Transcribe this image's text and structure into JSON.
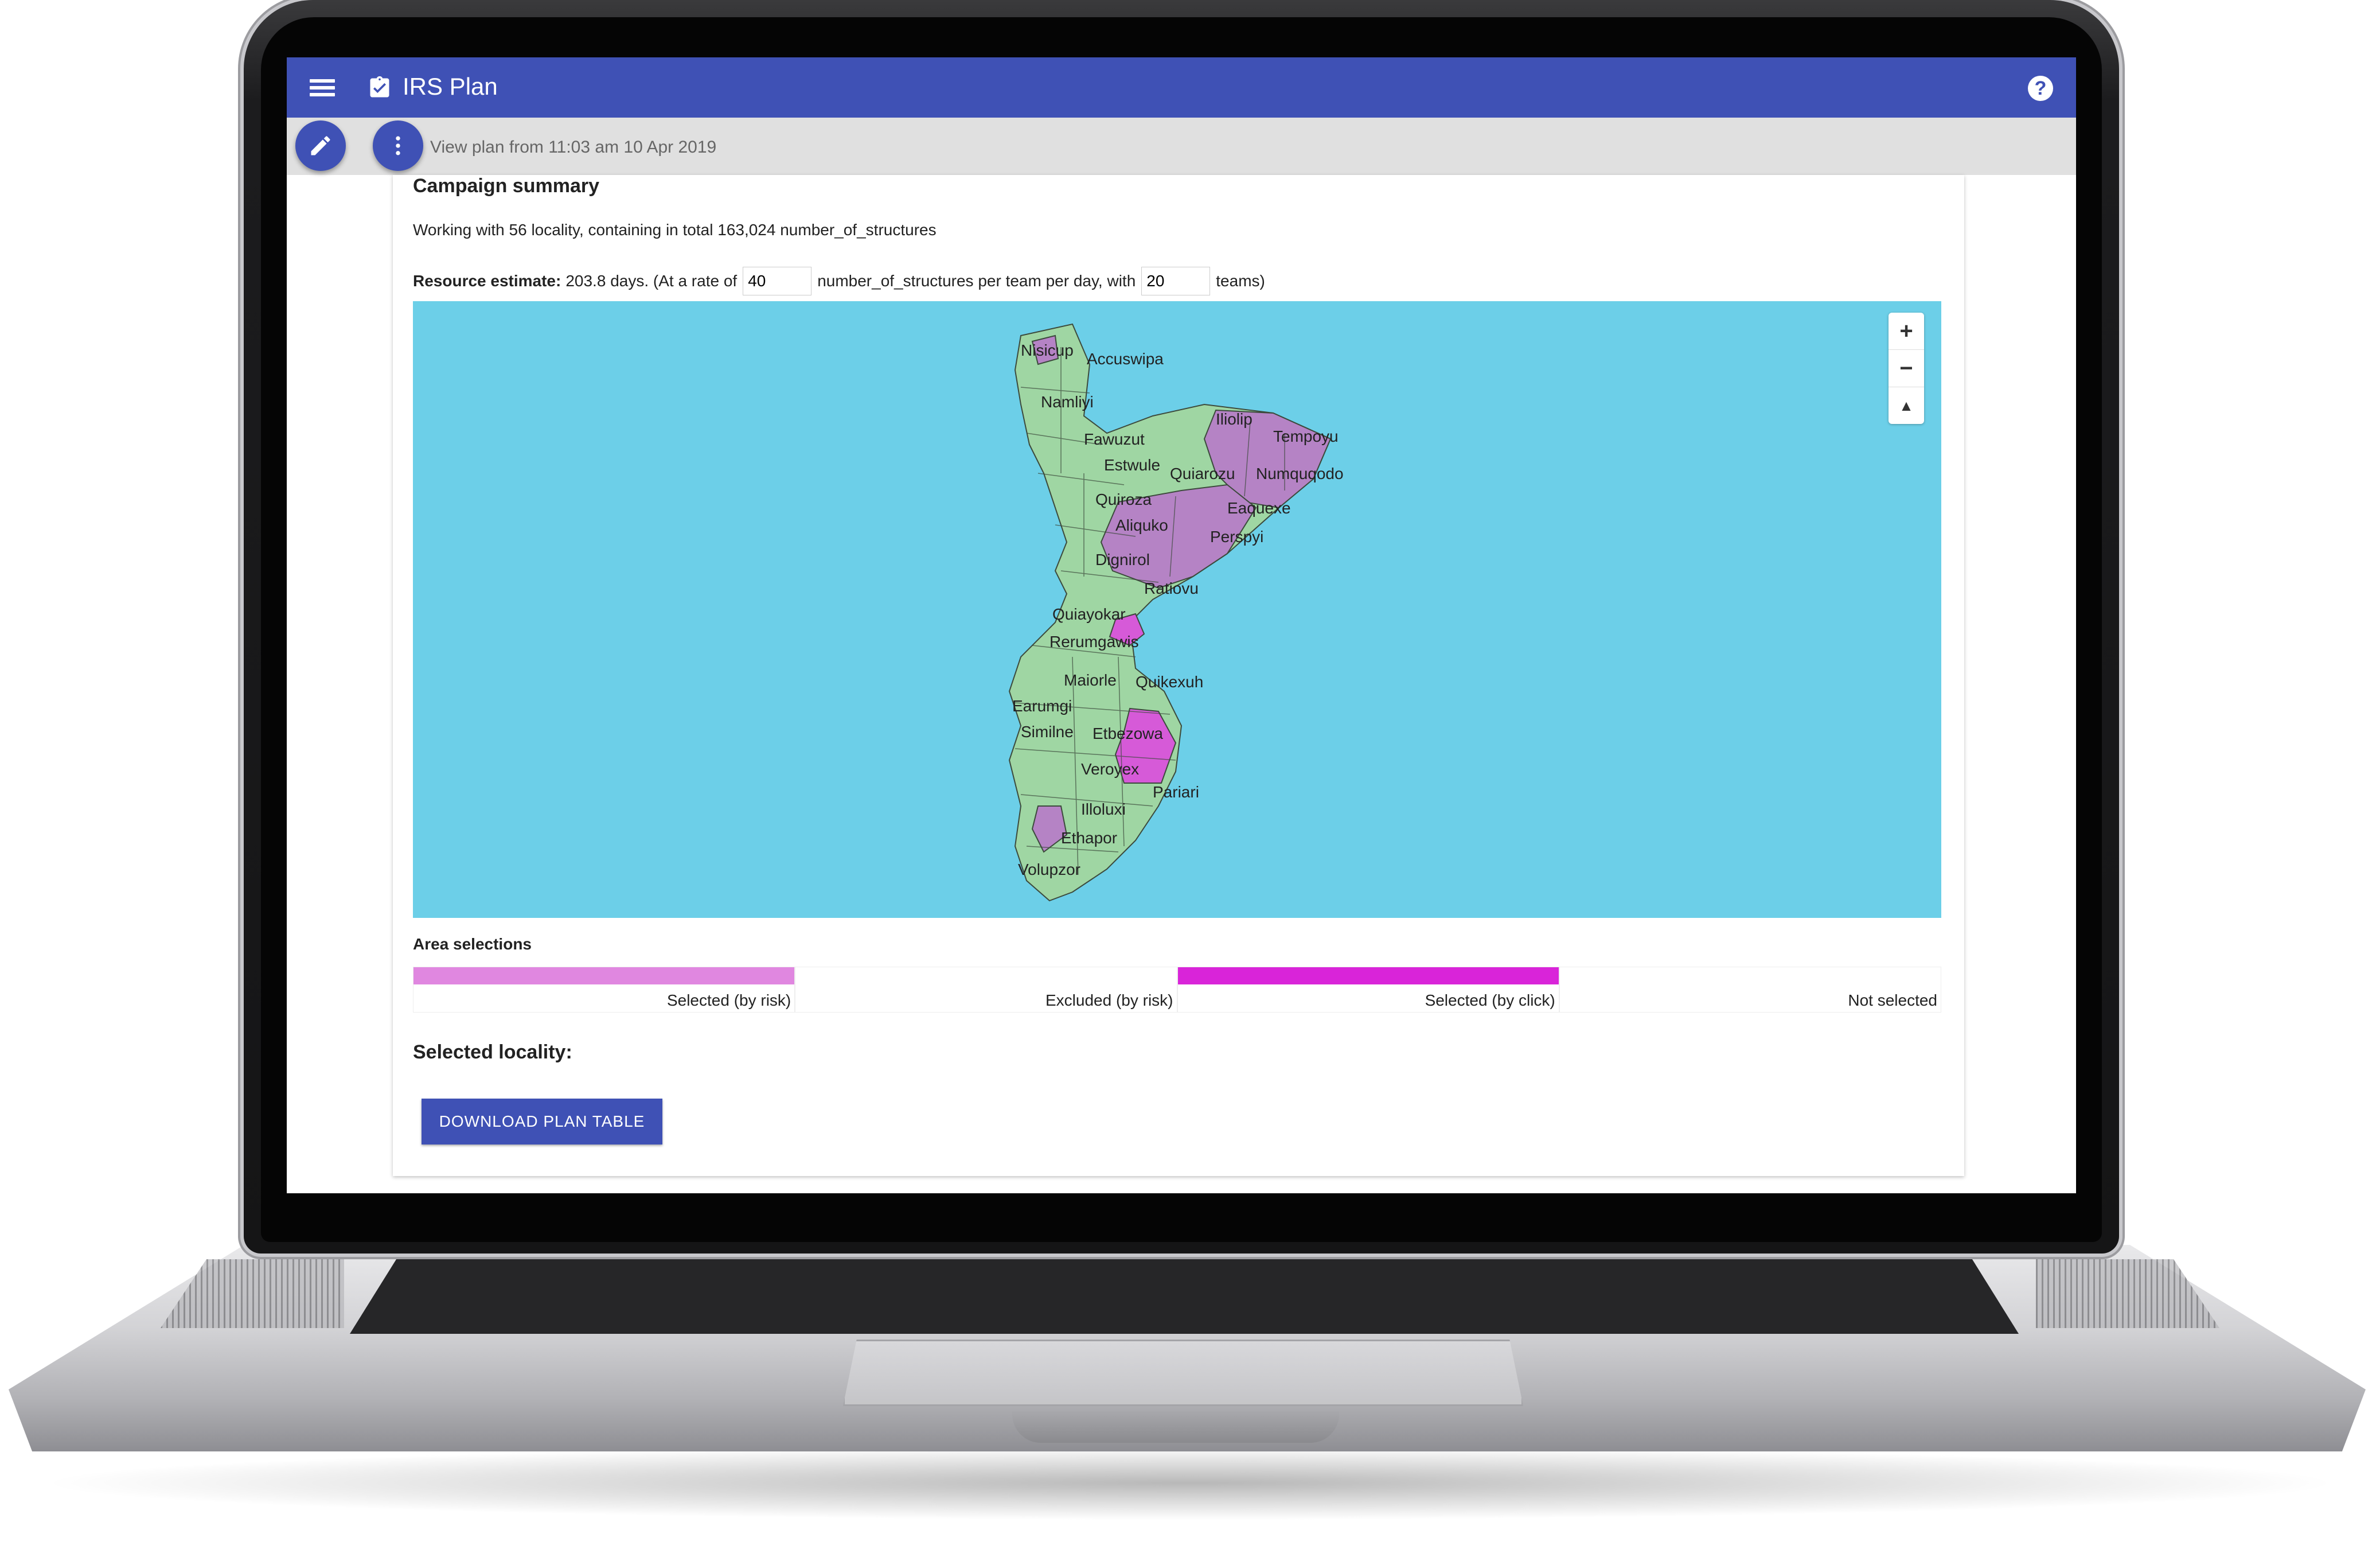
{
  "app": {
    "title": "IRS Plan",
    "help_label": "?"
  },
  "toolbar": {
    "plan_caption": "View plan from 11:03 am 10 Apr 2019"
  },
  "summary": {
    "title": "Campaign summary",
    "working_text": "Working with 56 locality, containing in total 163,024 number_of_structures",
    "estimate_label": "Resource estimate:",
    "estimate_days": "203.8 days. (At a rate of",
    "rate_value": "40",
    "rate_suffix": "number_of_structures per team per day, with",
    "teams_value": "20",
    "teams_suffix": "teams)"
  },
  "map": {
    "zoom_in": "+",
    "zoom_out": "−",
    "reset_north": "▲",
    "colors": {
      "water": "#6ccfe8",
      "land": "#9fd6a3",
      "selected_risk": "#b583c5",
      "selected_click": "#d65ad8",
      "border": "#3c4a3c"
    },
    "labels": [
      "Nisicup",
      "Accuswipa",
      "Namliyi",
      "Fawuzut",
      "Estwule",
      "Quiarozu",
      "Iliolip",
      "Tempoyu",
      "Numquqodo",
      "Quiroza",
      "Aliquko",
      "Eaquexe",
      "Perspyi",
      "Dignirol",
      "Ratiovu",
      "Quiayokar",
      "Rerumgawis",
      "Maiorle",
      "Quikexuh",
      "Earumgi",
      "Similne",
      "Etbezowa",
      "Veroyex",
      "Pariari",
      "Illoluxi",
      "Ethapor",
      "Volupzor"
    ]
  },
  "areas": {
    "title": "Area selections",
    "legend": [
      {
        "label": "Selected (by risk)",
        "color": "#e087e0"
      },
      {
        "label": "Excluded (by risk)",
        "color": "#ffffff"
      },
      {
        "label": "Selected (by click)",
        "color": "#d924d9"
      },
      {
        "label": "Not selected",
        "color": "#ffffff"
      }
    ]
  },
  "selected": {
    "heading": "Selected locality:"
  },
  "actions": {
    "download_label": "DOWNLOAD PLAN TABLE"
  }
}
